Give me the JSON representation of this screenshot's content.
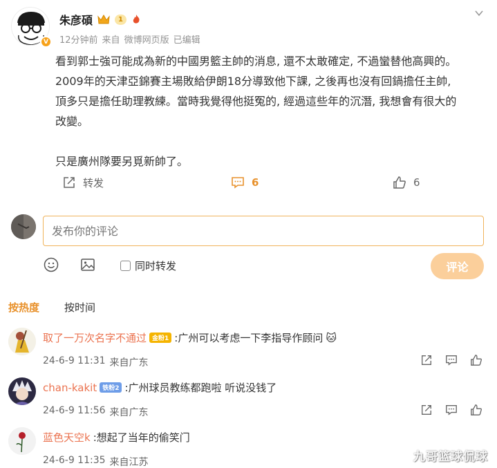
{
  "post": {
    "author": "朱彦碩",
    "level_badge": "1",
    "verified_badge": "V",
    "time": "12分钟前",
    "source_prefix": "来自",
    "source": "微博网页版",
    "edited": "已编辑",
    "body_lines": [
      "看到郭士強可能成為新的中國男籃主帥的消息, 還不太敢確定, 不過蠻替他高興的。",
      "2009年的天津亞錦賽主場敗給伊朗18分導致他下課, 之後再也沒有回鍋擔任主帥,",
      "頂多只是擔任助理教練。當時我覺得他挺冤的, 經過這些年的沉潛, 我想會有很大的",
      "改變。",
      "只是廣州隊要另覓新帥了。"
    ],
    "actions": {
      "repost_label": "转发",
      "comment_count": "6",
      "like_count": "6"
    }
  },
  "composer": {
    "placeholder": "发布你的评论",
    "repost_label": "同时转发",
    "submit_label": "评论"
  },
  "sort_tabs": {
    "hot": "按热度",
    "time": "按时间"
  },
  "comments": [
    {
      "user": "取了一万次名字不通过",
      "badge": "金粉1",
      "badge_color": "#f5b400",
      "text": ":广州可以考虑一下李指导作顾问",
      "emoji": "🐱",
      "date": "24-6-9 11:31",
      "location": "来自广东"
    },
    {
      "user": "chan-kakit",
      "badge": "铁粉2",
      "badge_color": "#6e9de8",
      "text": ":广州球员教练都跑啦 听说没钱了",
      "date": "24-6-9 11:56",
      "location": "来自广东"
    },
    {
      "user": "蓝色天空k",
      "text": ":想起了当年的偷笑门",
      "date": "24-6-9 11:35",
      "location": "来自江苏"
    }
  ],
  "watermark": "九哥篮球侃球",
  "colors": {
    "accent": "#e8912b",
    "username": "#eb7350",
    "submit_disabled": "#fbcf9b",
    "input_border": "#f0b35a"
  }
}
